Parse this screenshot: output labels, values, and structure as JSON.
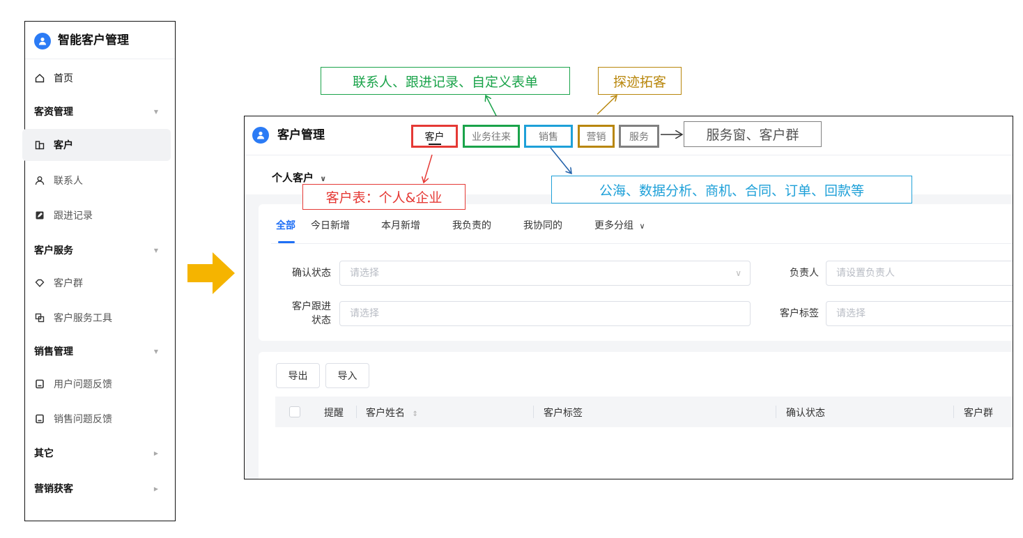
{
  "sidebar": {
    "app_title": "智能客户管理",
    "home": "首页",
    "groups": {
      "customer_mgmt": "客资管理",
      "customer_service": "客户服务",
      "sales_mgmt": "销售管理",
      "other": "其它",
      "marketing": "营销获客"
    },
    "items": {
      "customer": "客户",
      "contacts": "联系人",
      "followup": "跟进记录",
      "customer_group": "客户群",
      "service_tools": "客户服务工具",
      "user_feedback": "用户问题反馈",
      "sales_feedback": "销售问题反馈"
    }
  },
  "main": {
    "title": "客户管理",
    "top_tabs": [
      "客户",
      "业务往来",
      "销售",
      "营销",
      "服务"
    ],
    "view_selector": "个人客户",
    "sub_tabs": [
      "全部",
      "今日新增",
      "本月新增",
      "我负责的",
      "我协同的",
      "更多分组"
    ],
    "filters": {
      "confirm_status": {
        "label": "确认状态",
        "placeholder": "请选择"
      },
      "owner": {
        "label": "负责人",
        "placeholder": "请设置负责人"
      },
      "follow_status": {
        "label_line1": "客户跟进",
        "label_line2": "状态",
        "placeholder": "请选择"
      },
      "tags": {
        "label": "客户标签",
        "placeholder": "请选择"
      }
    },
    "buttons": {
      "export": "导出",
      "import": "导入"
    },
    "table_headers": [
      "提醒",
      "客户姓名",
      "客户标签",
      "确认状态",
      "客户群"
    ]
  },
  "annotations": {
    "customer_table": "客户表：个人&企业",
    "business": "联系人、跟进记录、自定义表单",
    "marketing": "探迹拓客",
    "sales": "公海、数据分析、商机、合同、订单、回款等",
    "service": "服务窗、客户群"
  },
  "colors": {
    "customer": "#e53935",
    "business": "#1aa34a",
    "marketing": "#b8860b",
    "sales": "#1ea0d8",
    "service": "#808080",
    "arrow": "#f5b400",
    "accent": "#1f6ff5"
  }
}
